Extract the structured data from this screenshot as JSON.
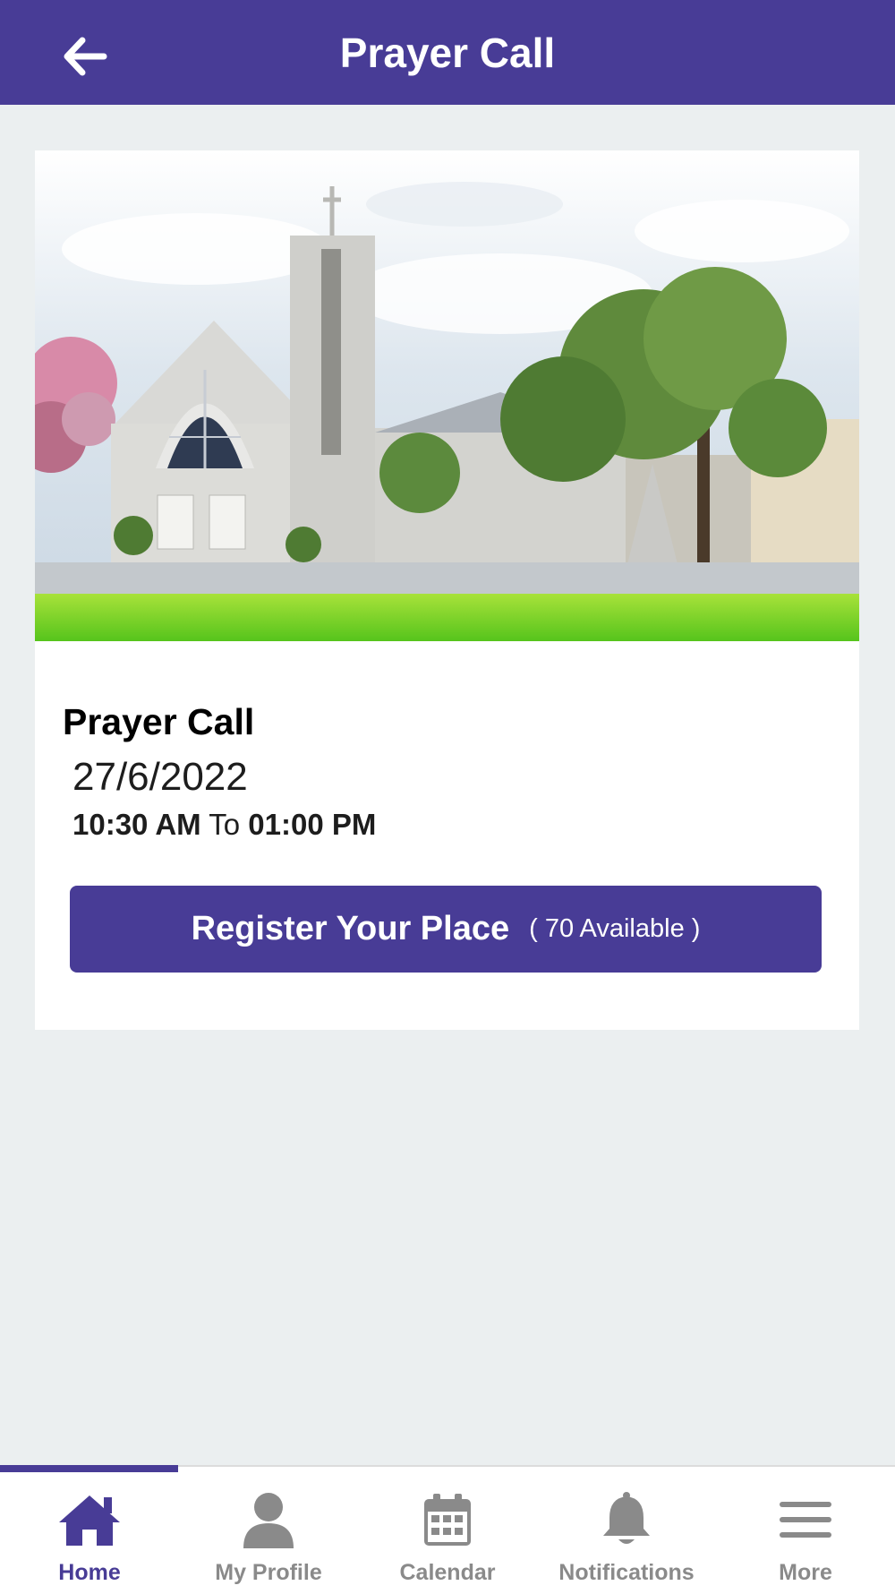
{
  "header": {
    "title": "Prayer Call",
    "back_icon": "arrow-left-icon"
  },
  "event": {
    "image": "church-building-photo",
    "title": "Prayer Call",
    "date": "27/6/2022",
    "start_time": "10:30 AM",
    "time_separator": "To",
    "end_time": "01:00 PM",
    "register_label": "Register Your Place",
    "availability": "( 70 Available )"
  },
  "tabs": [
    {
      "label": "Home",
      "icon": "home-icon",
      "active": true
    },
    {
      "label": "My Profile",
      "icon": "person-icon",
      "active": false
    },
    {
      "label": "Calendar",
      "icon": "calendar-icon",
      "active": false
    },
    {
      "label": "Notifications",
      "icon": "bell-icon",
      "active": false
    },
    {
      "label": "More",
      "icon": "menu-icon",
      "active": false
    }
  ],
  "colors": {
    "primary": "#483c96",
    "background": "#ebeff0",
    "inactive_tab": "#8a8a8a"
  }
}
